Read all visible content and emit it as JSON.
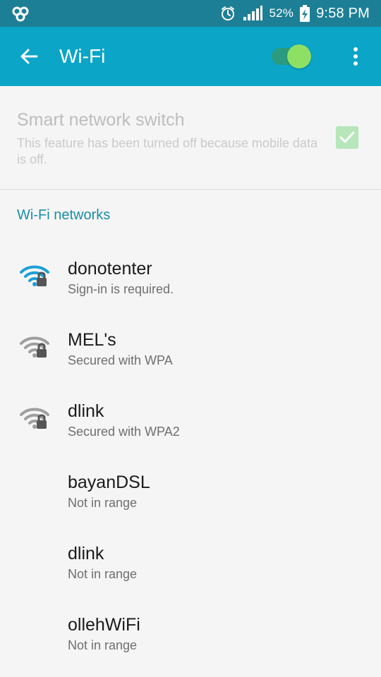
{
  "status_bar": {
    "battery_percent": "52%",
    "time": "9:58 PM",
    "icons": [
      "app-notification-icon",
      "alarm-icon",
      "signal-icon",
      "battery-charging-icon"
    ]
  },
  "app_bar": {
    "title": "Wi-Fi",
    "wifi_enabled": true,
    "icons": [
      "back-arrow-icon",
      "overflow-menu-icon"
    ],
    "colors": {
      "status_bar": "#1d7f95",
      "app_bar": "#0aa5c7",
      "toggle_thumb": "#8ee065",
      "toggle_track": "#2b9b80"
    }
  },
  "smart_switch": {
    "title": "Smart network switch",
    "summary": "This feature has been turned off because mobile data is off.",
    "checked": true
  },
  "section": {
    "title": "Wi-Fi networks"
  },
  "networks": [
    {
      "name": "donotenter",
      "status": "Sign-in is required.",
      "signal_icon": "wifi-lock-icon",
      "icon_color": "#1aa0d8"
    },
    {
      "name": "MEL's",
      "status": "Secured with WPA",
      "signal_icon": "wifi-lock-icon",
      "icon_color": "#9e9e9e"
    },
    {
      "name": "dlink",
      "status": "Secured with WPA2",
      "signal_icon": "wifi-lock-icon",
      "icon_color": "#9e9e9e"
    },
    {
      "name": "bayanDSL",
      "status": "Not in range"
    },
    {
      "name": "dlink",
      "status": "Not in range"
    },
    {
      "name": "ollehWiFi",
      "status": "Not in range"
    }
  ]
}
